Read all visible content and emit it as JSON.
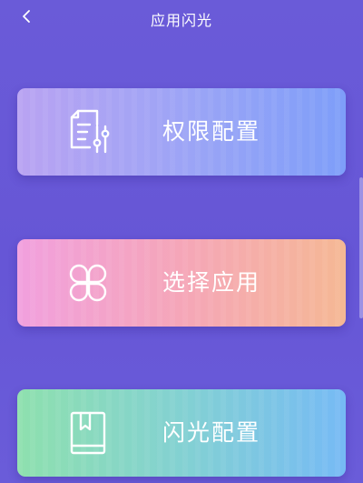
{
  "header": {
    "back_icon": "chevron-left-icon",
    "title": "应用闪光"
  },
  "cards": [
    {
      "label": "权限配置",
      "icon": "document-settings-icon"
    },
    {
      "label": "选择应用",
      "icon": "clover-icon"
    },
    {
      "label": "闪光配置",
      "icon": "book-icon"
    }
  ],
  "colors": {
    "background": "#6656d6",
    "card1_start": "#b9a3f2",
    "card1_end": "#7e9ef9",
    "card2_start": "#f1a0de",
    "card2_end": "#f5b894",
    "card3_start": "#8ee0ae",
    "card3_end": "#76baf5",
    "text": "#ffffff"
  }
}
